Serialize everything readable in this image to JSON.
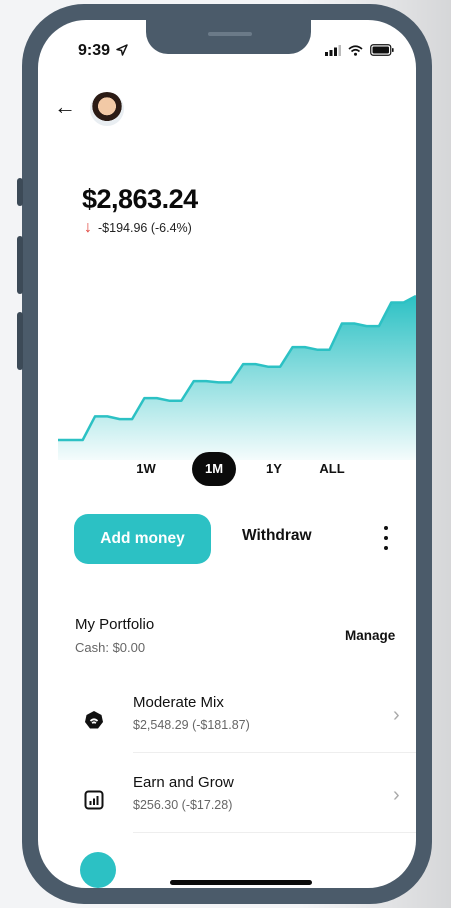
{
  "status_bar": {
    "time": "9:39"
  },
  "portfolio_header": {
    "balance": "$2,863.24",
    "change": "-$194.96 (-6.4%)"
  },
  "chart_data": {
    "type": "area",
    "series": [
      {
        "values": [
          0.0,
          0.0,
          0.0,
          0.18,
          0.18,
          0.16,
          0.16,
          0.32,
          0.32,
          0.3,
          0.3,
          0.45,
          0.45,
          0.44,
          0.44,
          0.58,
          0.58,
          0.56,
          0.56,
          0.71,
          0.71,
          0.69,
          0.69,
          0.89,
          0.89,
          0.87,
          0.87,
          1.05,
          1.05,
          1.1
        ]
      }
    ],
    "color": "#2cc1c4",
    "grid": false
  },
  "ranges": [
    {
      "label": "1W",
      "active": false
    },
    {
      "label": "1M",
      "active": true
    },
    {
      "label": "1Y",
      "active": false
    },
    {
      "label": "ALL",
      "active": false
    }
  ],
  "actions": {
    "add_money": "Add money",
    "withdraw": "Withdraw"
  },
  "portfolio": {
    "title": "My Portfolio",
    "cash": "Cash: $0.00",
    "manage": "Manage",
    "items": [
      {
        "name": "Moderate Mix",
        "value": "$2,548.29 (-$181.87)",
        "icon": "moderate-mix-icon"
      },
      {
        "name": "Earn and Grow",
        "value": "$256.30 (-$17.28)",
        "icon": "bar-chart-icon"
      }
    ]
  },
  "colors": {
    "accent": "#2cc1c4",
    "negative": "#e0433b",
    "frame": "#4b5b6a"
  }
}
